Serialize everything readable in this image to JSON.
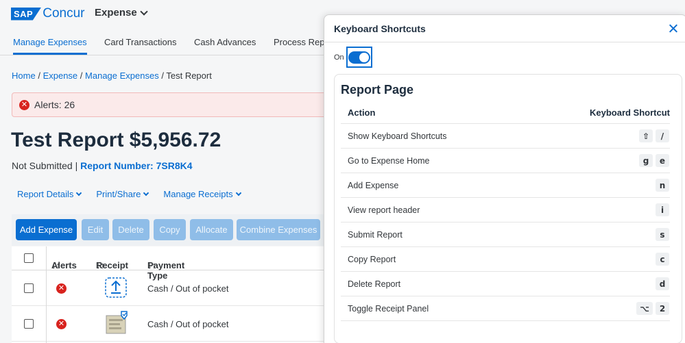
{
  "app": {
    "logo_sap": "SAP",
    "logo_concur": "Concur",
    "module": "Expense"
  },
  "nav": {
    "items": [
      "Manage Expenses",
      "Card Transactions",
      "Cash Advances",
      "Process Repo"
    ]
  },
  "breadcrumb": {
    "items": [
      "Home",
      "Expense",
      "Manage Expenses",
      "Test Report"
    ],
    "separator": "/"
  },
  "alerts": {
    "text": "Alerts: 26"
  },
  "report": {
    "title": "Test Report $5,956.72",
    "status": "Not Submitted |",
    "number": "Report Number: 7SR8K4"
  },
  "menus": [
    "Report Details",
    "Print/Share",
    "Manage Receipts"
  ],
  "toolbar": {
    "buttons": [
      "Add Expense",
      "Edit",
      "Delete",
      "Copy",
      "Allocate",
      "Combine Expenses"
    ]
  },
  "table": {
    "columns": [
      "Alerts",
      "Receipt",
      "Payment Type"
    ],
    "sort_glyph": "↓↑",
    "rows": [
      {
        "payment_type": "Cash / Out of pocket"
      },
      {
        "payment_type": "Cash / Out of pocket"
      }
    ]
  },
  "dialog": {
    "title": "Keyboard Shortcuts",
    "toggle_label": "On",
    "toggle_on": true,
    "section_title": "Report Page",
    "col_action": "Action",
    "col_shortcut": "Keyboard Shortcut",
    "shortcuts": [
      {
        "action": "Show Keyboard Shortcuts",
        "keys": [
          "⇧",
          "/"
        ]
      },
      {
        "action": "Go to Expense Home",
        "keys": [
          "g",
          "e"
        ]
      },
      {
        "action": "Add Expense",
        "keys": [
          "n"
        ]
      },
      {
        "action": "View report header",
        "keys": [
          "i"
        ]
      },
      {
        "action": "Submit Report",
        "keys": [
          "s"
        ]
      },
      {
        "action": "Copy Report",
        "keys": [
          "c"
        ]
      },
      {
        "action": "Delete Report",
        "keys": [
          "d"
        ]
      },
      {
        "action": "Toggle Receipt Panel",
        "keys": [
          "⌥",
          "2"
        ]
      }
    ]
  },
  "colors": {
    "accent": "#0a6ed1",
    "error": "#d8231e",
    "alert_bg": "#fbeaea"
  }
}
